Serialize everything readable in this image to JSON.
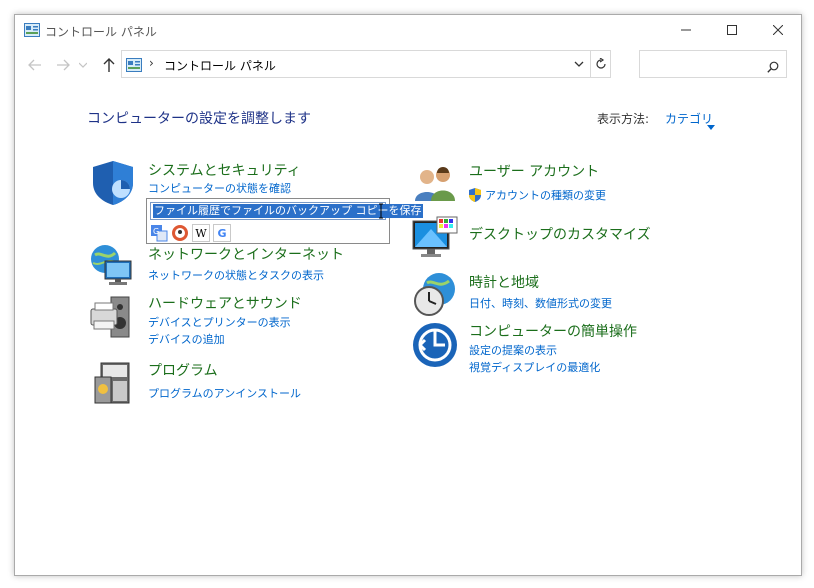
{
  "window": {
    "title": "コントロール パネル"
  },
  "address": {
    "separator": "›",
    "path": "コントロール パネル"
  },
  "search": {
    "placeholder": ""
  },
  "header": {
    "title": "コンピューターの設定を調整します",
    "view_label": "表示方法:",
    "view_value": "カテゴリ"
  },
  "categories": [
    {
      "title": "システムとセキュリティ",
      "links": [
        "コンピューターの状態を確認"
      ]
    },
    {
      "title": "ネットワークとインターネット",
      "links": [
        "ネットワークの状態とタスクの表示"
      ]
    },
    {
      "title": "ハードウェアとサウンド",
      "links": [
        "デバイスとプリンターの表示",
        "デバイスの追加"
      ]
    },
    {
      "title": "プログラム",
      "links": [
        "プログラムのアンインストール"
      ]
    },
    {
      "title": "ユーザー アカウント",
      "links": [
        "アカウントの種類の変更"
      ]
    },
    {
      "title": "デスクトップのカスタマイズ",
      "links": []
    },
    {
      "title": "時計と地域",
      "links": [
        "日付、時刻、数値形式の変更"
      ]
    },
    {
      "title": "コンピューターの簡単操作",
      "links": [
        "設定の提案の表示",
        "視覚ディスプレイの最適化"
      ]
    }
  ],
  "popup": {
    "selected_text": "ファイル履歴でファイルのバックアップ コピーを保存",
    "tools": [
      "translate-icon",
      "duckduckgo-icon",
      "wikipedia-icon",
      "google-icon"
    ],
    "wikipedia_letter": "W",
    "google_letter": "G"
  },
  "colors": {
    "heading": "#1e3287",
    "category_title": "#1b6e1b",
    "link": "#0066cc",
    "selection": "#2b70c9"
  }
}
